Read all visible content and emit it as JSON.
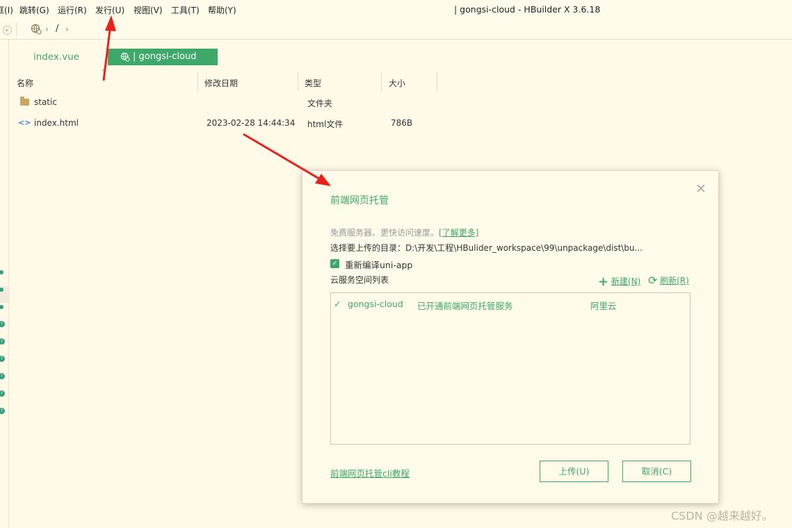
{
  "menubar": {
    "items": [
      "框(I)",
      "跳转(G)",
      "运行(R)",
      "发行(U)",
      "视图(V)",
      "工具(T)",
      "帮助(Y)"
    ],
    "app_title": "| gongsi-cloud - HBuilder X 3.6.18"
  },
  "addressbar": {
    "path": "/"
  },
  "tabs": [
    {
      "label": "index.vue"
    },
    {
      "label": "| gongsi-cloud"
    }
  ],
  "file_list": {
    "columns": [
      "名称",
      "修改日期",
      "类型",
      "大小"
    ],
    "rows": [
      {
        "name": "static",
        "date": "",
        "type": "文件夹",
        "size": "",
        "icon": "folder-icon"
      },
      {
        "name": "index.html",
        "date": "2023-02-28 14:44:34",
        "type": "html文件",
        "size": "786B",
        "icon": "code-icon"
      }
    ]
  },
  "dialog": {
    "title": "前端网页托管",
    "free_text": "免费服务器、更快访问速度。",
    "learn_more": "[了解更多]",
    "upload_dir": "选择要上传的目录：D:\\开发\\工程\\HBulider_workspace\\99\\unpackage\\dist\\bu...",
    "recompile_label": "重新编译uni-app",
    "recompile_checked": true,
    "space_list_title": "云服务空间列表",
    "new_label": "新建(N)",
    "refresh_label": "刷新(R)",
    "spaces": [
      {
        "name": "gongsi-cloud",
        "status": "已开通前端网页托管服务",
        "provider": "阿里云"
      }
    ],
    "cli_tutorial": "前端网页托管cli教程",
    "upload_button": "上传(U)",
    "cancel_button": "取消(C)"
  },
  "watermark": "CSDN @越来越好。",
  "colors": {
    "accent": "#3ea86a",
    "background": "#fffae8",
    "annotation": "#e8221b"
  }
}
